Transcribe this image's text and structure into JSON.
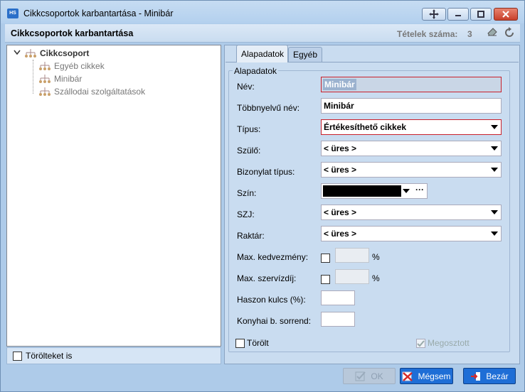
{
  "window": {
    "title": "Cikkcsoportok karbantartása - Minibár",
    "app_icon_text": "HS",
    "controls": [
      "move-icon",
      "minimize-icon",
      "maximize-icon",
      "close-icon"
    ]
  },
  "header": {
    "title": "Cikkcsoportok karbantartása",
    "count_label": "Tételek száma:",
    "count_value": "3",
    "icons": [
      "eraser-icon",
      "refresh-icon"
    ]
  },
  "tree": {
    "root": {
      "label": "Cikkcsoport",
      "expanded": true
    },
    "children": [
      {
        "label": "Egyéb cikkek"
      },
      {
        "label": "Minibár"
      },
      {
        "label": "Szállodai szolgáltatások"
      }
    ]
  },
  "deleted_toggle": {
    "label": "Törölteket is",
    "checked": false
  },
  "tabs": [
    {
      "label": "Alapadatok",
      "active": true
    },
    {
      "label": "Egyéb",
      "active": false
    }
  ],
  "form": {
    "group_title": "Alapadatok",
    "fields": {
      "nev": {
        "label": "Név:",
        "value": "Minibár"
      },
      "tobbnyelvu": {
        "label": "Többnyelvű név:",
        "value": "Minibár"
      },
      "tipus": {
        "label": "Típus:",
        "value": "Értékesíthető cikkek"
      },
      "szulo": {
        "label": "Szülő:",
        "value": "< üres >"
      },
      "bizonylat": {
        "label": "Bizonylat típus:",
        "value": "< üres >"
      },
      "szin": {
        "label": "Szín:",
        "value": "#000000"
      },
      "szj": {
        "label": "SZJ:",
        "value": "< üres >"
      },
      "raktar": {
        "label": "Raktár:",
        "value": "< üres >"
      },
      "max_kedv": {
        "label": "Max. kedvezmény:",
        "unit": "%"
      },
      "max_szerv": {
        "label": "Max. szervízdíj:",
        "unit": "%"
      },
      "haszon": {
        "label": "Haszon kulcs (%):"
      },
      "konyhai": {
        "label": "Konyhai b. sorrend:"
      }
    },
    "torolt": {
      "label": "Törölt",
      "checked": false
    },
    "megosztott": {
      "label": "Megosztott",
      "checked": true
    }
  },
  "buttons": {
    "ok": "OK",
    "cancel": "Mégsem",
    "close": "Bezár"
  },
  "colors": {
    "required_border": "#c9202b",
    "accent_button": "#1e6ed6",
    "panel_bg": "#c9dcf0"
  }
}
